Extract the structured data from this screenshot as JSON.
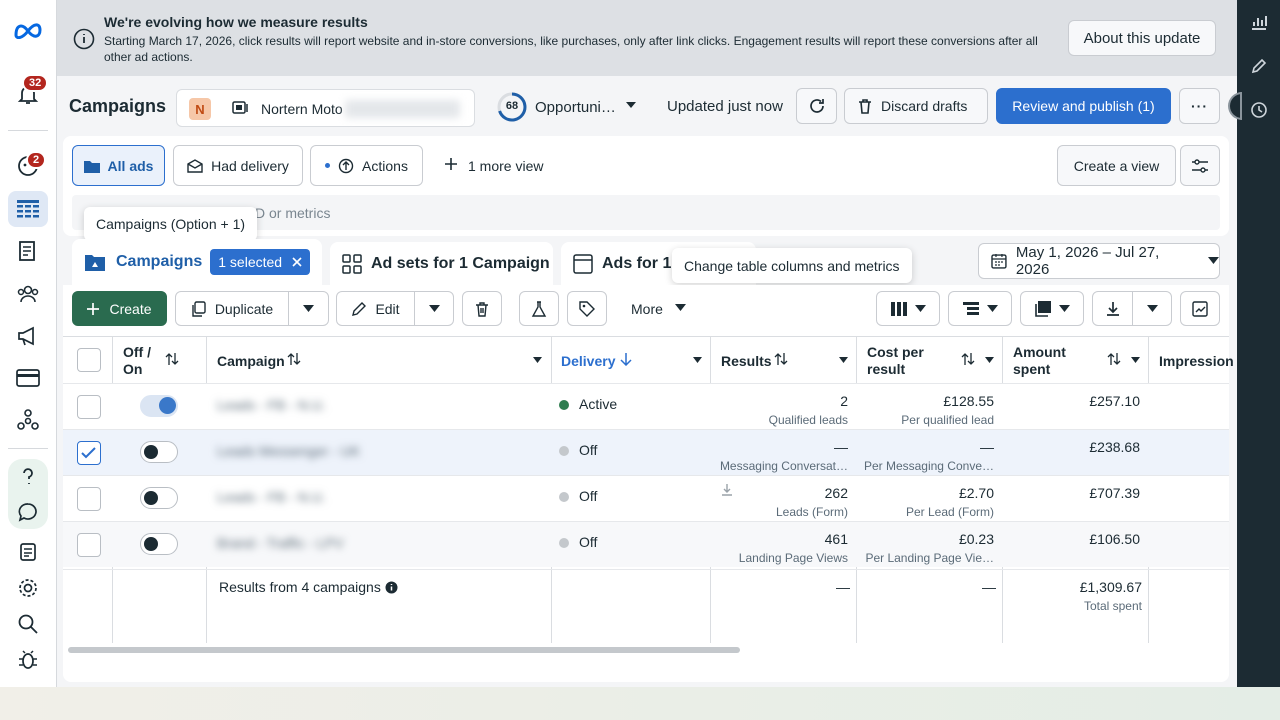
{
  "nav": {
    "notifications_badge": "32",
    "messages_badge": "2"
  },
  "banner": {
    "title": "We're evolving how we measure results",
    "body": "Starting March 17, 2026, click results will report website and in-store conversions, like purchases, only after link clicks. Engagement results will report these conversions after all other ad actions.",
    "about_button": "About this update"
  },
  "header": {
    "title": "Campaigns",
    "account_initial": "N",
    "account_name": "Nortern Moto",
    "opportunity_score": "68",
    "opportunity_label": "Opportuni…",
    "updated": "Updated just now",
    "discard": "Discard drafts",
    "review": "Review and publish (1)"
  },
  "views": {
    "all_ads": "All ads",
    "had_delivery": "Had delivery",
    "actions": "Actions",
    "more_view": "1 more view",
    "create_view": "Create a view"
  },
  "search": {
    "placeholder": "D or metrics"
  },
  "tooltips": {
    "campaigns": "Campaigns (Option + 1)",
    "columns": "Change table columns and metrics"
  },
  "level_tabs": {
    "campaigns": "Campaigns",
    "selected": "1 selected",
    "adsets": "Ad sets for 1 Campaign",
    "ads": "Ads for 1 C"
  },
  "date_range": "May 1, 2026 – Jul 27, 2026",
  "toolbar": {
    "create": "Create",
    "duplicate": "Duplicate",
    "edit": "Edit",
    "more": "More"
  },
  "table": {
    "headers": {
      "offon": "Off / On",
      "campaign": "Campaign",
      "delivery": "Delivery",
      "results": "Results",
      "cpr": "Cost per result",
      "spent": "Amount spent",
      "impressions": "Impression"
    },
    "rows": [
      {
        "name": "Leads - FB - N.U.",
        "delivery": "Active",
        "status_color": "#2e7d4f",
        "on": true,
        "checked": false,
        "results": "2",
        "results_sub": "Qualified leads",
        "cpr": "£128.55",
        "cpr_sub": "Per qualified lead",
        "spent": "£257.10"
      },
      {
        "name": "Leads Messenger - UK",
        "delivery": "Off",
        "status_color": "#c4c8cc",
        "on": false,
        "checked": true,
        "results": "—",
        "results_sub": "Messaging Conversat…",
        "cpr": "—",
        "cpr_sub": "Per Messaging Conve…",
        "spent": "£238.68"
      },
      {
        "name": "Leads - FB - N.U.",
        "delivery": "Off",
        "status_color": "#c4c8cc",
        "on": false,
        "checked": false,
        "results": "262",
        "results_sub": "Leads (Form)",
        "cpr": "£2.70",
        "cpr_sub": "Per Lead (Form)",
        "spent": "£707.39"
      },
      {
        "name": "Brand - Traffic - LPV",
        "delivery": "Off",
        "status_color": "#c4c8cc",
        "on": false,
        "checked": false,
        "results": "461",
        "results_sub": "Landing Page Views",
        "cpr": "£0.23",
        "cpr_sub": "Per Landing Page Vie…",
        "spent": "£106.50"
      }
    ],
    "summary": {
      "label": "Results from 4 campaigns",
      "results": "—",
      "cpr": "—",
      "spent": "£1,309.67",
      "spent_sub": "Total spent"
    }
  }
}
